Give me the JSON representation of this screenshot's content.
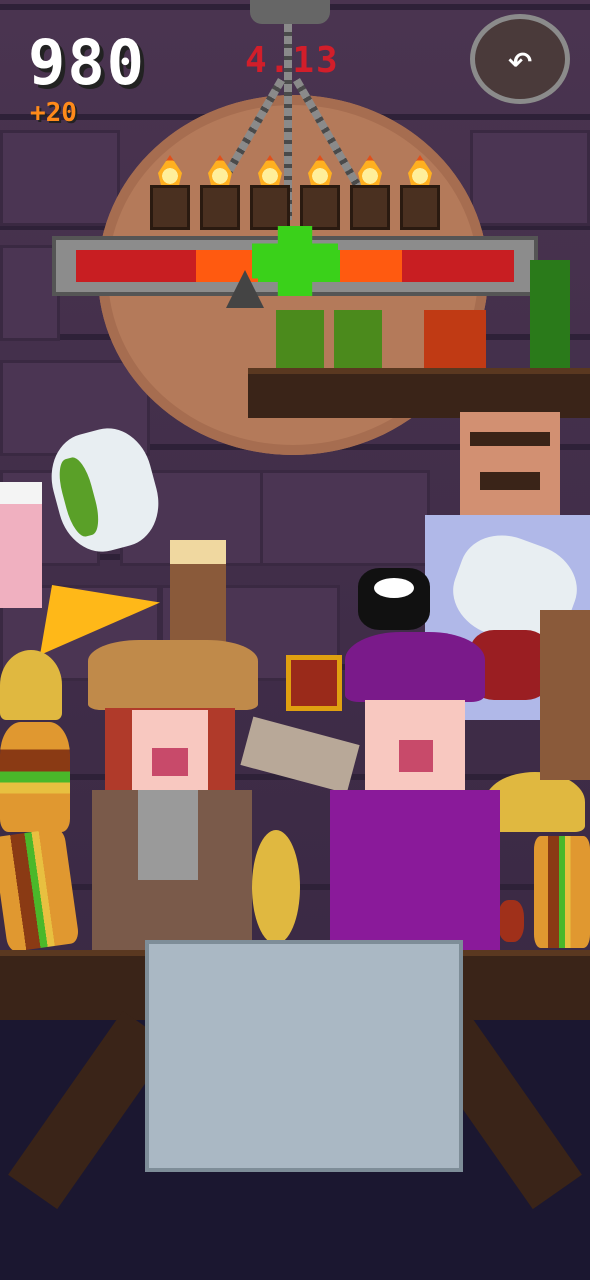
{
  "hud": {
    "score": "980",
    "bonus": "+20",
    "timer": "4.13",
    "back_icon": "undo-arrow-icon"
  },
  "meter": {
    "colors": {
      "red": "#c81e22",
      "orange": "#ff5a10",
      "green": "#3ad11a"
    }
  },
  "items": [
    "milkshake",
    "pot",
    "beer-mug",
    "pizza-slice",
    "sushi",
    "taco",
    "burger",
    "potion",
    "pistol",
    "steak",
    "cupcake"
  ]
}
